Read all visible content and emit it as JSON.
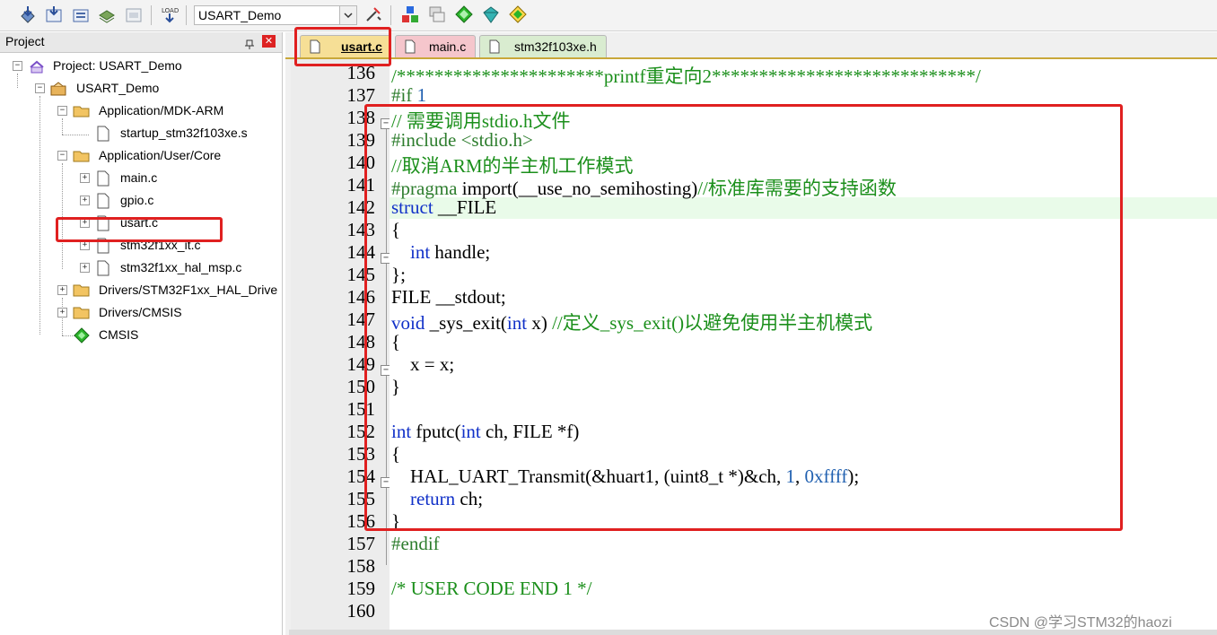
{
  "toolbar": {
    "target_value": "USART_Demo",
    "icons": [
      "build-icon",
      "rebuild-icon",
      "batch-build-icon",
      "stop-build-icon",
      "download-icon",
      "load-icon",
      "target-options-icon",
      "manage-components-icon",
      "pack-installer-icon",
      "select-software-packs-icon",
      "manage-run-time-icon",
      "configure-icon"
    ]
  },
  "project_panel": {
    "title": "Project",
    "tree": {
      "project": "Project: USART_Demo",
      "target": "USART_Demo",
      "groups": [
        {
          "label": "Application/MDK-ARM",
          "files": [
            "startup_stm32f103xe.s"
          ]
        },
        {
          "label": "Application/User/Core",
          "files": [
            "main.c",
            "gpio.c",
            "usart.c",
            "stm32f1xx_it.c",
            "stm32f1xx_hal_msp.c"
          ]
        },
        {
          "label": "Drivers/STM32F1xx_HAL_Drive"
        },
        {
          "label": "Drivers/CMSIS"
        },
        {
          "label": "CMSIS"
        }
      ]
    }
  },
  "editor": {
    "tabs": [
      {
        "label": "usart.c",
        "active": true,
        "color": "#f6df96"
      },
      {
        "label": "main.c",
        "active": false,
        "color": "#f5c6cc"
      },
      {
        "label": "stm32f103xe.h",
        "active": false,
        "color": "#d9ecd0"
      }
    ],
    "line_numbers": [
      "136",
      "137",
      "138",
      "139",
      "140",
      "141",
      "142",
      "143",
      "144",
      "145",
      "146",
      "147",
      "148",
      "149",
      "150",
      "151",
      "152",
      "153",
      "154",
      "155",
      "156",
      "157",
      "158",
      "159",
      "160"
    ],
    "lines": {
      "l136": "/**********************printf重定向2****************************/",
      "l137a": "#if",
      "l137b": " 1",
      "l138": "// 需要调用stdio.h文件",
      "l139a": "#include",
      "l139b": " <stdio.h>",
      "l140": "//取消ARM的半主机工作模式",
      "l141a": "#pragma",
      "l141b": " import(__use_no_semihosting)",
      "l141c": "//标准库需要的支持函数",
      "l142a": "struct",
      "l142b": " __FILE",
      "l143": "{",
      "l144a": "    int",
      "l144b": " handle;",
      "l145": "};",
      "l146": "FILE __stdout;",
      "l147a": "void",
      "l147b": " _sys_exit(",
      "l147c": "int",
      "l147d": " x) ",
      "l147e": "//定义_sys_exit()以避免使用半主机模式",
      "l148": "{",
      "l149": "    x = x;",
      "l150": "}",
      "l152a": "int",
      "l152b": " fputc(",
      "l152c": "int",
      "l152d": " ch, FILE *f)",
      "l153": "{",
      "l154a": "    HAL_UART_Transmit(&huart1, (uint8_t *)&ch, ",
      "l154b": "1",
      "l154c": ", ",
      "l154d": "0xffff",
      "l154e": ");",
      "l155a": "    return",
      "l155b": " ch;",
      "l156": "}",
      "l157": "#endif",
      "l159": "/* USER CODE END 1 */"
    }
  },
  "watermark": "CSDN @学习STM32的haozi",
  "colors": {
    "highlight_box": "#e02020",
    "keyword": "#1030c8",
    "comment": "#1b8f1b",
    "preprocessor": "#2d7d2d"
  }
}
